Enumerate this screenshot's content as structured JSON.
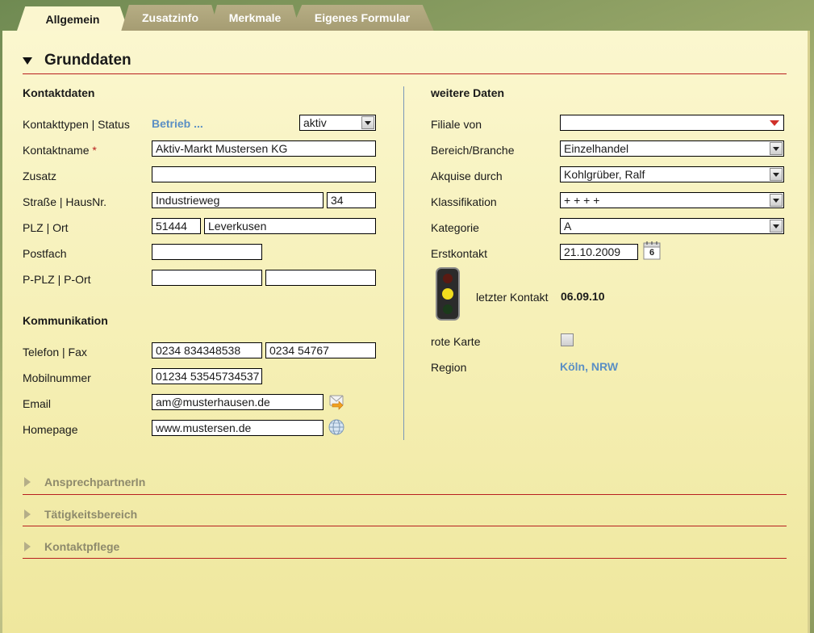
{
  "tabs": [
    {
      "label": "Allgemein",
      "active": true
    },
    {
      "label": "Zusatzinfo"
    },
    {
      "label": "Merkmale"
    },
    {
      "label": "Eigenes Formular"
    }
  ],
  "section_title": "Grunddaten",
  "left": {
    "contact_heading": "Kontaktdaten",
    "labels": {
      "types_status": "Kontakttypen | Status",
      "name": "Kontaktname",
      "name_required": "*",
      "zusatz": "Zusatz",
      "street": "Straße | HausNr.",
      "plz_ort": "PLZ | Ort",
      "postfach": "Postfach",
      "pplz_port": "P-PLZ | P-Ort"
    },
    "values": {
      "types_link": "Betrieb ...",
      "status": "aktiv",
      "name": "Aktiv-Markt Mustersen KG",
      "zusatz": "",
      "street": "Industrieweg",
      "house_no": "34",
      "plz": "51444",
      "ort": "Leverkusen",
      "postfach": "",
      "pplz": "",
      "port": ""
    },
    "comm_heading": "Kommunikation",
    "comm_labels": {
      "phone_fax": "Telefon | Fax",
      "mobile": "Mobilnummer",
      "email": "Email",
      "homepage": "Homepage"
    },
    "comm_values": {
      "phone": "0234 834348538",
      "fax": "0234 54767",
      "mobile": "01234 53545734537",
      "email": "am@musterhausen.de",
      "homepage": "www.mustersen.de"
    }
  },
  "right": {
    "heading": "weitere Daten",
    "labels": {
      "filiale": "Filiale von",
      "branche": "Bereich/Branche",
      "akquise": "Akquise durch",
      "klass": "Klassifikation",
      "kategorie": "Kategorie",
      "erstkontakt": "Erstkontakt",
      "letzter": "letzter Kontakt",
      "rote_karte": "rote Karte",
      "region": "Region"
    },
    "values": {
      "filiale": "",
      "branche": "Einzelhandel",
      "akquise": "Kohlgrüber, Ralf",
      "klass": "+ + + +",
      "kategorie": "A",
      "erstkontakt": "21.10.2009",
      "calendar_day": "6",
      "letzter": "06.09.10",
      "rote_karte_checked": false,
      "region": "Köln, NRW"
    }
  },
  "collapsed_sections": [
    "AnsprechpartnerIn",
    "Tätigkeitsbereich",
    "Kontaktpflege"
  ],
  "colors": {
    "accent_line": "#b81f1f",
    "link": "#5b8fc4",
    "panel": "#fbf6cf"
  }
}
